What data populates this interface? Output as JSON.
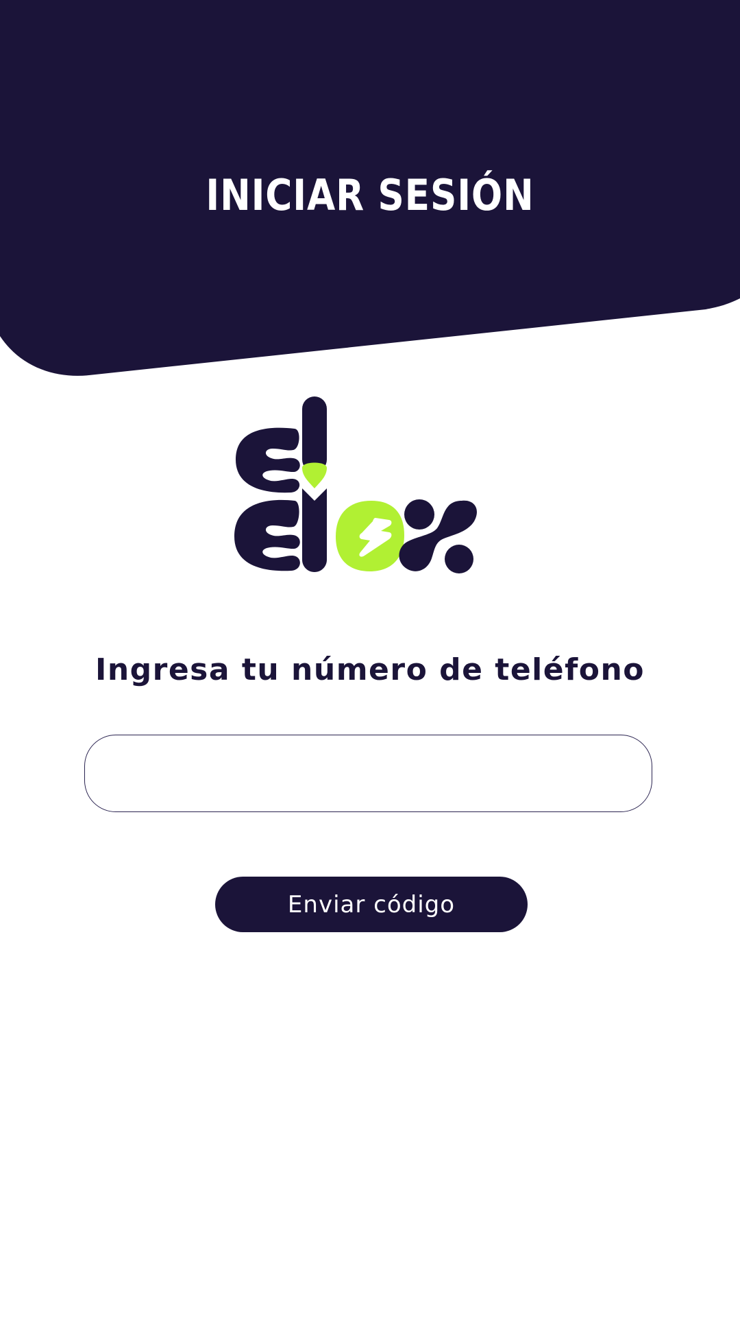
{
  "colors": {
    "primary_dark": "#1b1439",
    "accent_green": "#b1f033",
    "background": "#ffffff"
  },
  "header": {
    "title": "INICIAR SESIÓN"
  },
  "logo": {
    "brand": "clicx",
    "icon": "lightning-bolt-icon"
  },
  "form": {
    "prompt": "Ingresa tu número de teléfono",
    "phone_value": "",
    "phone_placeholder": "",
    "submit_label": "Enviar código"
  }
}
